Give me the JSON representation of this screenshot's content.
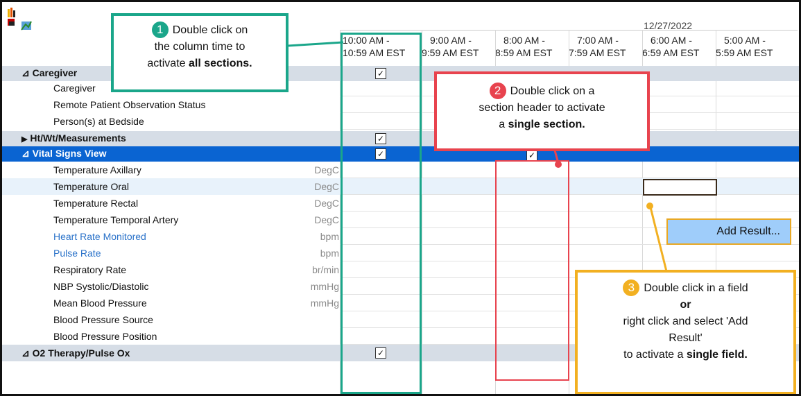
{
  "date": "12/27/2022",
  "columns": [
    {
      "line1": "10:00 AM -",
      "line2": "10:59 AM EST"
    },
    {
      "line1": "9:00 AM -",
      "line2": "9:59 AM EST"
    },
    {
      "line1": "8:00 AM -",
      "line2": "8:59 AM EST"
    },
    {
      "line1": "7:00 AM -",
      "line2": "7:59 AM EST"
    },
    {
      "line1": "6:00 AM -",
      "line2": "6:59 AM EST"
    },
    {
      "line1": "5:00 AM -",
      "line2": "5:59 AM EST"
    }
  ],
  "rows": [
    {
      "label": "Caregiver",
      "unit": ""
    },
    {
      "label": "Caregiver",
      "unit": ""
    },
    {
      "label": "Remote Patient Observation Status",
      "unit": ""
    },
    {
      "label": "Person(s) at Bedside",
      "unit": ""
    },
    {
      "label": "Ht/Wt/Measurements",
      "unit": ""
    },
    {
      "label": "Vital Signs View",
      "unit": ""
    },
    {
      "label": "Temperature Axillary",
      "unit": "DegC"
    },
    {
      "label": "Temperature Oral",
      "unit": "DegC"
    },
    {
      "label": "Temperature Rectal",
      "unit": "DegC"
    },
    {
      "label": "Temperature Temporal Artery",
      "unit": "DegC"
    },
    {
      "label": "Heart Rate Monitored",
      "unit": "bpm"
    },
    {
      "label": "Pulse Rate",
      "unit": "bpm"
    },
    {
      "label": "Respiratory Rate",
      "unit": "br/min"
    },
    {
      "label": "NBP Systolic/Diastolic",
      "unit": "mmHg"
    },
    {
      "label": "Mean Blood Pressure",
      "unit": "mmHg"
    },
    {
      "label": "Blood Pressure Source",
      "unit": ""
    },
    {
      "label": "Blood Pressure Position",
      "unit": ""
    },
    {
      "label": "O2 Therapy/Pulse Ox",
      "unit": ""
    }
  ],
  "glyphs": {
    "collapse": "⊿",
    "expand": "▶",
    "check": "✓"
  },
  "callouts": {
    "c1": {
      "num": "1",
      "line1": "Double click on",
      "line2": "the column time to",
      "line3a": "activate ",
      "line3b": "all sections."
    },
    "c2": {
      "num": "2",
      "line1": "Double click on a",
      "line2": "section header to activate",
      "line3a": "a ",
      "line3b": "single section."
    },
    "c3": {
      "num": "3",
      "line1": "Double click in a field",
      "line2": "or",
      "line3": "right click and select 'Add",
      "line4": "Result'",
      "line5a": "to activate a ",
      "line5b": "single field."
    }
  },
  "context_menu": {
    "add_result": "Add Result..."
  },
  "colors": {
    "green": "#1aa68a",
    "red": "#e8434e",
    "orange": "#f2b021",
    "selected": "#0a64d2"
  }
}
